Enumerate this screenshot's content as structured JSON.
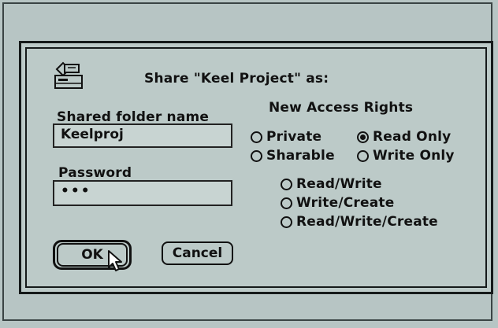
{
  "dialog": {
    "title": "Share \"Keel Project\" as:",
    "folder_label": "Shared folder name",
    "folder_value": "Keelproj",
    "password_label": "Password",
    "password_value": "•••",
    "access_title": "New Access Rights",
    "options": {
      "private": "Private",
      "read_only": "Read Only",
      "sharable": "Sharable",
      "write_only": "Write Only",
      "read_write": "Read/Write",
      "write_create": "Write/Create",
      "read_write_create": "Read/Write/Create"
    },
    "selected": "Read Only",
    "ok_label": "OK",
    "cancel_label": "Cancel"
  }
}
